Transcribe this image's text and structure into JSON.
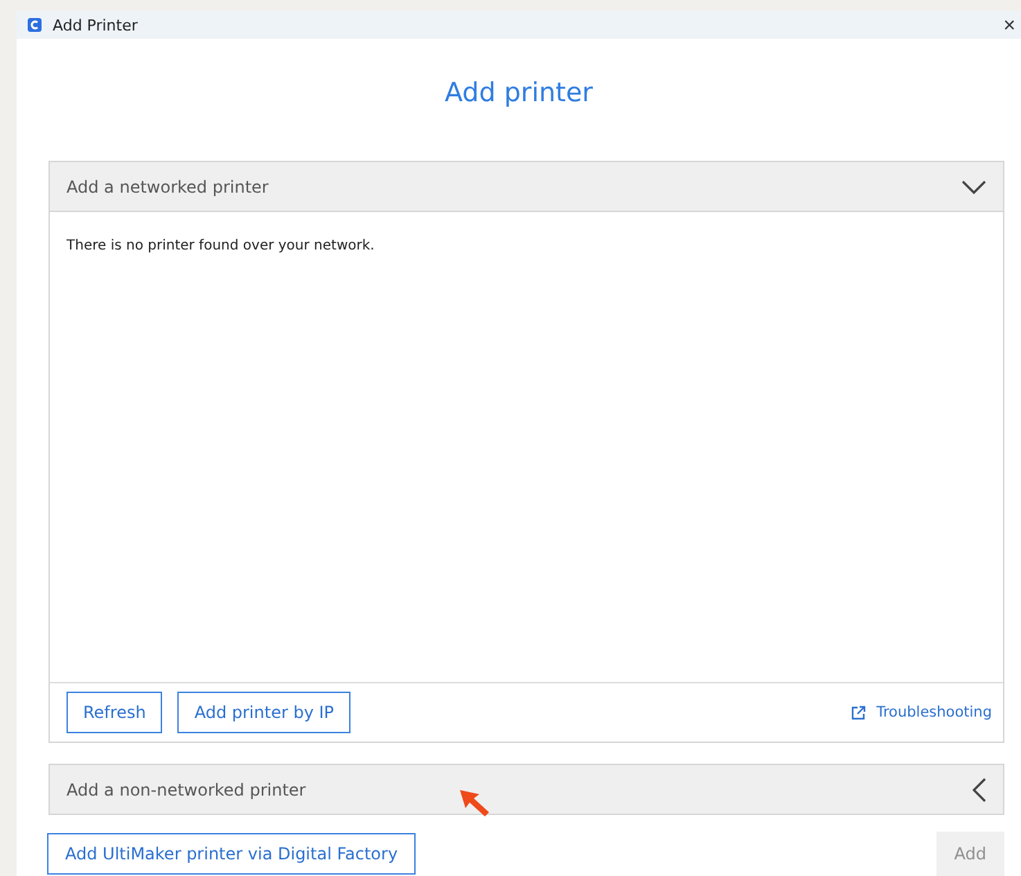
{
  "window": {
    "title": "Add Printer",
    "close": "×"
  },
  "heading": "Add printer",
  "sections": [
    {
      "title": "Add a networked printer",
      "expanded": true,
      "message": "There is no printer found over your network.",
      "buttons": [
        "Refresh",
        "Add printer by IP"
      ],
      "link": "Troubleshooting"
    },
    {
      "title": "Add a non-networked printer",
      "expanded": false
    }
  ],
  "footer": {
    "left_button": {
      "label": "Add UltiMaker printer via Digital Factory",
      "disabled": false
    },
    "right_button": {
      "label": "Add",
      "disabled": true
    }
  }
}
